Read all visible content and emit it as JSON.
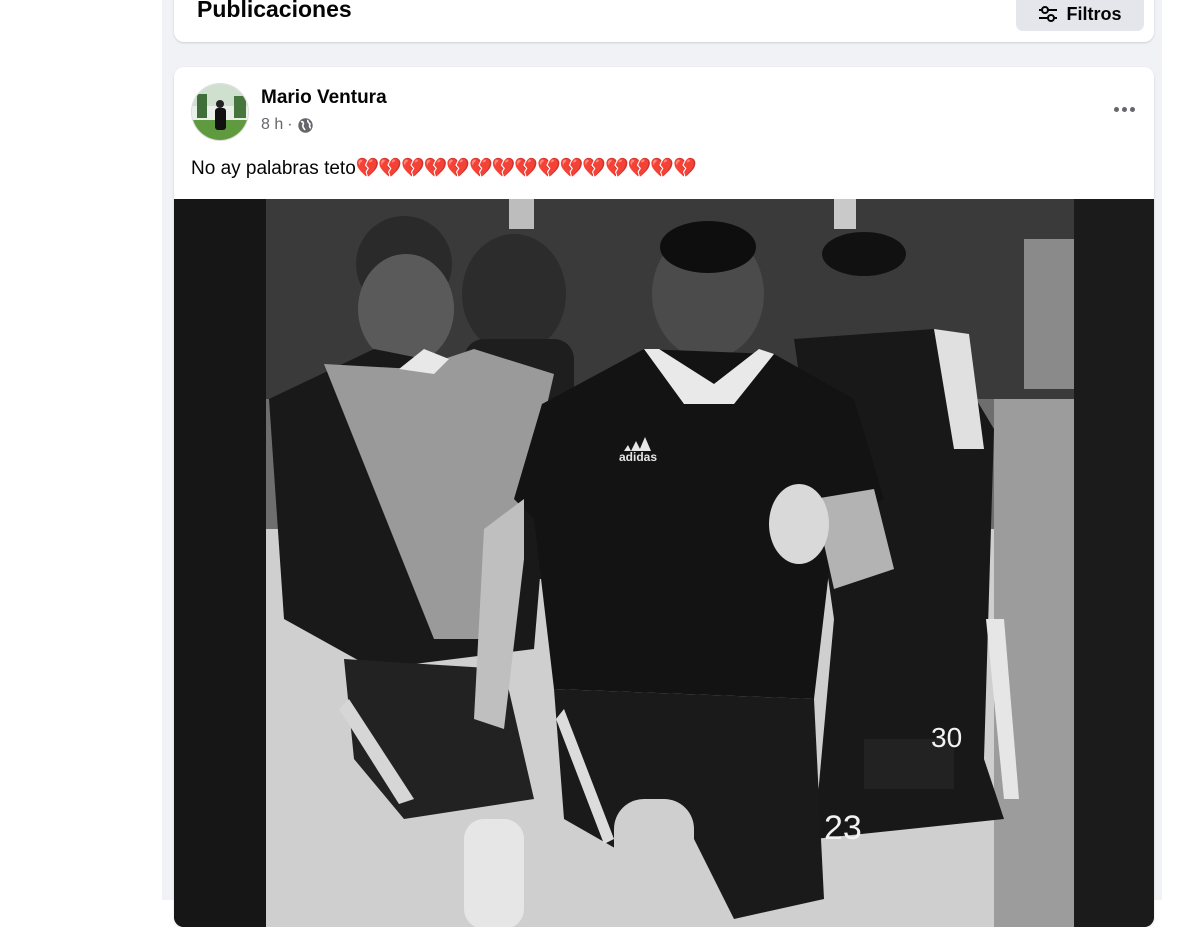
{
  "header": {
    "title": "Publicaciones",
    "filter_label": "Filtros",
    "filter_icon": "sliders-icon"
  },
  "post": {
    "author": "Mario Ventura",
    "time": "8 h",
    "separator": "·",
    "privacy_icon": "globe-icon",
    "text": "No ay palabras teto",
    "hearts": "💔💔💔💔💔💔💔💔💔💔💔💔💔💔💔",
    "more_icon": "more-options-icon",
    "photo": {
      "jersey_numbers": [
        "23",
        "30"
      ],
      "brand": "adidas",
      "style": "black-and-white"
    }
  },
  "colors": {
    "page_bg": "#f0f2f5",
    "card_bg": "#ffffff",
    "button_bg": "#e4e6eb",
    "secondary_text": "#65676b",
    "heart_red": "#d81b3c"
  }
}
